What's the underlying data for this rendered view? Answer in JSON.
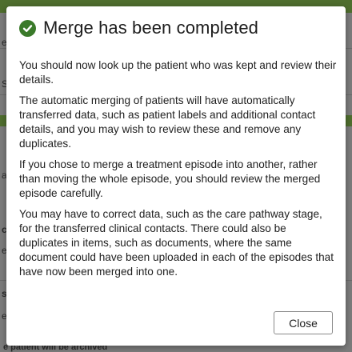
{
  "background": {
    "fragments": [
      "e",
      "S",
      "a",
      "cs",
      "e",
      "s",
      "e"
    ],
    "footer_text": "e patient will be archived"
  },
  "dialog": {
    "title": "Merge has been completed",
    "icon": "check-circle-icon",
    "accent_color": "#3a7a2a",
    "paragraphs": [
      "You should now look up the patient who was kept and review their details.",
      "The automatic merging of patients will have automatically transferred data, such as patient labels and additional contact details, and you may wish to review these and remove any duplicates.",
      "If you chose to merge a treatment episode into another, rather than moving the whole episode, you should review the merged episode carefully.",
      "You may have to correct data, such as the care pathway stage, for the transferred clinical contacts. There could also be duplicates in items, such as documents, where the same document could have been uploaded in each of the episodes that have now been merged into one."
    ],
    "close_label": "Close"
  }
}
